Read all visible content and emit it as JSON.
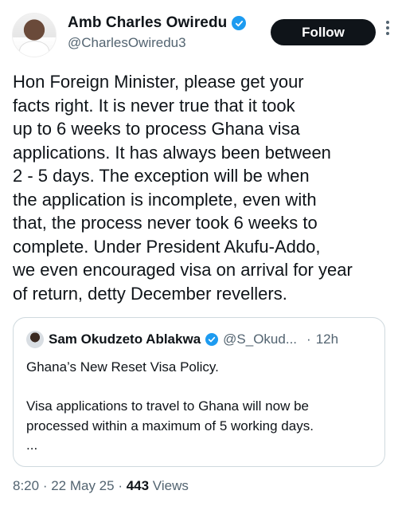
{
  "author": {
    "name": "Amb Charles Owiredu",
    "handle": "@CharlesOwiredu3",
    "verified": true
  },
  "follow_label": "Follow",
  "more_icon": "more-dots-icon",
  "post_text": "Hon Foreign Minister, please get your\nfacts right. It is never true that it took\nup to 6 weeks to process Ghana visa\napplications. It has always been between\n2 - 5 days. The exception will be when\nthe application is incomplete, even with\nthat, the process never took 6 weeks to\ncomplete. Under President Akufu-Addo,\nwe even encouraged visa on arrival for year\nof return, detty December revellers.",
  "quoted": {
    "name": "Sam Okudzeto Ablakwa",
    "handle": "@S_Okud...",
    "separator": "·",
    "time": "12h",
    "text": "Ghana’s New Reset Visa Policy.\n\nVisa applications to travel to Ghana will now be\nprocessed within a maximum of 5 working days.\n..."
  },
  "meta": {
    "time": "8:20",
    "sep1": " · ",
    "date": "22 May 25",
    "sep2": " · ",
    "views_count": "443",
    "views_label": " Views"
  },
  "colors": {
    "verified": "#1d9bf0",
    "follow_bg": "#0f1419",
    "secondary_text": "#536471"
  }
}
